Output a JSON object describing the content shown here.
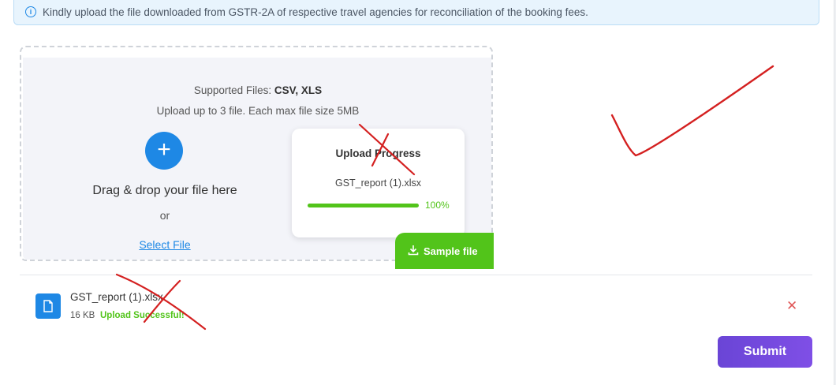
{
  "info_banner": {
    "icon": "info-icon",
    "text": "Kindly upload the file downloaded from GSTR-2A of respective travel agencies for reconciliation of the booking fees."
  },
  "dropzone": {
    "supported_label": "Supported Files: ",
    "supported_types": "CSV, XLS",
    "limit_text": "Upload up to 3 file. Each max file size 5MB",
    "add_icon": "plus-icon",
    "drag_text": "Drag & drop your file here",
    "or_text": "or",
    "select_link": "Select File"
  },
  "progress": {
    "title": "Upload Progress",
    "file_name": "GST_report (1).xlsx",
    "percent": 100,
    "percent_text": "100%"
  },
  "sample_button": {
    "icon": "download-icon",
    "label": "Sample file"
  },
  "uploaded_file": {
    "icon": "document-icon",
    "name": "GST_report (1).xlsx",
    "size": "16 KB",
    "status": "Upload Successful!",
    "remove_icon": "close-icon"
  },
  "submit_label": "Submit",
  "colors": {
    "primary": "#1e88e5",
    "success": "#52c41a",
    "submit": "#7048e8",
    "annotation": "#d42020"
  }
}
